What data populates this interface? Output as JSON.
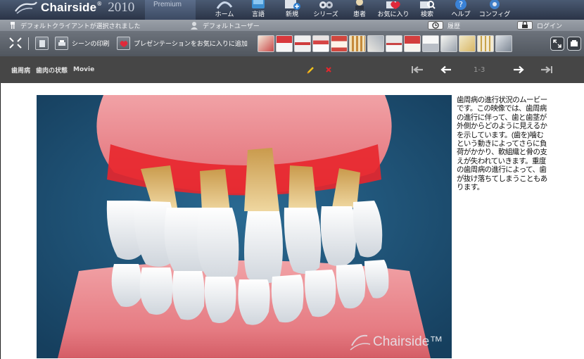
{
  "app": {
    "name": "Chairside",
    "year": "2010",
    "edition": "Premium"
  },
  "menu": [
    {
      "label": "ホーム",
      "icon": "home-icon"
    },
    {
      "label": "言語",
      "icon": "globe-icon"
    },
    {
      "label": "新規",
      "icon": "new-icon"
    },
    {
      "label": "シリーズ",
      "icon": "film-series-icon"
    },
    {
      "label": "患者",
      "icon": "patient-icon"
    },
    {
      "label": "お気に入り",
      "icon": "heart-icon"
    },
    {
      "label": "検索",
      "icon": "search-icon"
    },
    {
      "label": "ヘルプ",
      "icon": "help-icon"
    },
    {
      "label": "コンフィグ",
      "icon": "gear-icon"
    }
  ],
  "status": {
    "client": "デフォルトクライアントが選択されました",
    "user": "デフォルトユーザー",
    "history": "履歴",
    "login": "ログイン"
  },
  "toolbar": {
    "print_scene": "シーンの印刷",
    "add_favorite": "プレゼンテーションをお気に入りに追加"
  },
  "breadcrumb": [
    "歯周病",
    "歯肉の状態",
    "Movie"
  ],
  "pagination": {
    "current": "1-3"
  },
  "description": "歯周病の進行状況のムービーです。この映像では、歯周病の進行に伴って、歯と歯茎が外側からどのように見えるかを示しています。(歯を)噛むという動きによってさらに負荷がかかり、軟組織と骨の支えが失われていきます。重度の歯周病の進行によって、歯が抜け落ちてしまうこともあります。",
  "watermark": "Chairside™",
  "colors": {
    "accent_red": "#e8262c",
    "video_bg": "#1c4f73",
    "gum": "#e8848c"
  }
}
